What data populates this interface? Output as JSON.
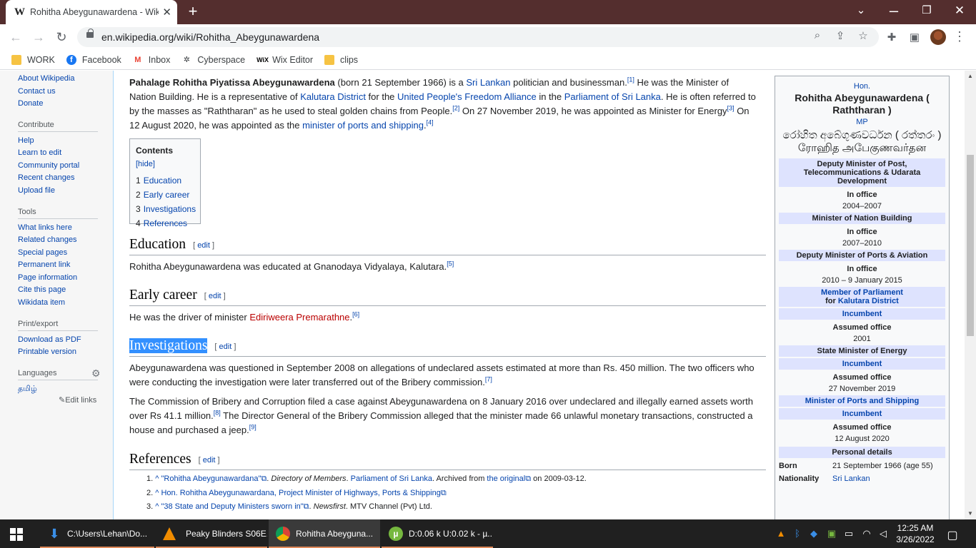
{
  "browser": {
    "tab_title": "Rohitha Abeygunawardena - Wik",
    "url": "en.wikipedia.org/wiki/Rohitha_Abeygunawardena",
    "bookmarks": [
      "WORK",
      "Facebook",
      "Inbox",
      "Cyberspace",
      "Wix Editor",
      "clips"
    ]
  },
  "sidebar": {
    "top_links": [
      "About Wikipedia",
      "Contact us",
      "Donate"
    ],
    "contribute_heading": "Contribute",
    "contribute_links": [
      "Help",
      "Learn to edit",
      "Community portal",
      "Recent changes",
      "Upload file"
    ],
    "tools_heading": "Tools",
    "tools_links": [
      "What links here",
      "Related changes",
      "Special pages",
      "Permanent link",
      "Page information",
      "Cite this page",
      "Wikidata item"
    ],
    "print_heading": "Print/export",
    "print_links": [
      "Download as PDF",
      "Printable version"
    ],
    "languages_heading": "Languages",
    "language_links": [
      "தமிழ்"
    ],
    "edit_links": "Edit links"
  },
  "article": {
    "intro": {
      "name": "Pahalage Rohitha Piyatissa Abeygunawardena",
      "born": " (born 21 September 1966) is a ",
      "sri_lankan": "Sri Lankan",
      "t1": " politician and businessman.",
      "r1": "[1]",
      "t2": " He was the Minister of Nation Building. He is a representative of ",
      "kalutara": "Kalutara District",
      "t3": " for the ",
      "upfa": "United People's Freedom Alliance",
      "t4": " in the ",
      "parliament": "Parliament of Sri Lanka",
      "t5": ". He is often referred to by the masses as \"Raththaran\" as he used to steal golden chains from People.",
      "r2": "[2]",
      "t6": " On 27 November 2019, he was appointed as Minister for Energy",
      "r3": "[3]",
      "t7": " On 12 August 2020, he was appointed as the ",
      "ports": "minister of ports and shipping",
      "t8": ".",
      "r4": "[4]"
    },
    "toc": {
      "title": "Contents",
      "hide": "[hide]",
      "items": [
        {
          "num": "1",
          "label": "Education"
        },
        {
          "num": "2",
          "label": "Early career"
        },
        {
          "num": "3",
          "label": "Investigations"
        },
        {
          "num": "4",
          "label": "References"
        }
      ]
    },
    "edit_open": "[ ",
    "edit_label": "edit",
    "edit_close": " ]",
    "education": {
      "heading": "Education",
      "text": "Rohitha Abeygunawardena was educated at Gnanodaya Vidyalaya, Kalutara.",
      "ref": "[5]"
    },
    "early_career": {
      "heading": "Early career",
      "text": "He was the driver of minister ",
      "link": "Ediriweera Premarathne",
      "end": ".",
      "ref": "[6]"
    },
    "investigations": {
      "heading": "Investigations",
      "p1": "Abeygunawardena was questioned in September 2008 on allegations of undeclared assets estimated at more than Rs. 450 million. The two officers who were conducting the investigation were later transferred out of the Bribery commission.",
      "p1_ref": "[7]",
      "p2a": "The Commission of Bribery and Corruption filed a case against Abeygunawardena on 8 January 2016 over undeclared and illegally earned assets worth over Rs 41.1 million.",
      "p2_ref1": "[8]",
      "p2b": " The Director General of the Bribery Commission alleged that the minister made 66 unlawful monetary transactions, constructed a house and purchased a jeep.",
      "p2_ref2": "[9]"
    },
    "references": {
      "heading": "References",
      "r1": {
        "num": "1.",
        "caret": "^",
        "title": "\"Rohitha Abeygunawardana\"",
        "ext": "⧉",
        "t1": ". ",
        "italic": "Directory of Members",
        "t2": ". ",
        "pub": "Parliament of Sri Lanka",
        "t3": ". Archived from ",
        "orig": "the original",
        "t4": " on 2009-03-12."
      },
      "r2": {
        "num": "2.",
        "caret": "^",
        "title": "Hon. Rohitha Abeygunawardana, Project Minister of Highways, Ports & Shipping",
        "ext": "⧉"
      },
      "r3": {
        "num": "3.",
        "caret": "^",
        "title": "\"38 State and Deputy Ministers sworn in\"",
        "ext": "⧉",
        "t1": ". ",
        "italic": "Newsfirst",
        "t2": ". MTV Channel (Pvt) Ltd."
      }
    }
  },
  "infobox": {
    "honorific": "Hon.",
    "name": "Rohitha Abeygunawardena ( Raththaran )",
    "post_nominal": "MP",
    "sinhala": "රෝහිත අබේගුණවර්ධන ( රත්තරං )",
    "tamil": "ரோஹித அபேகுணவர்தன",
    "offices": [
      {
        "title": "Deputy Minister of Post, Telecommunications & Udarata Development",
        "status": "In office",
        "dates": "2004–2007"
      },
      {
        "title": "Minister of Nation Building",
        "status": "In office",
        "dates": "2007–2010"
      },
      {
        "title": "Deputy Minister of Ports & Aviation",
        "status": "In office",
        "dates": "2010 – 9 January 2015"
      }
    ],
    "mp_title": "Member of Parliament",
    "mp_for": "for ",
    "mp_district": "Kalutara District",
    "incumbent": "Incumbent",
    "assumed": "Assumed office",
    "mp_date": "2001",
    "energy_title": "State Minister of Energy",
    "energy_date": "27 November 2019",
    "ports_title": "Minister of Ports and Shipping",
    "ports_date": "12 August 2020",
    "personal": "Personal details",
    "born_label": "Born",
    "born_value": "21 September 1966 (age 55)",
    "nationality_label": "Nationality",
    "nationality_value": "Sri Lankan"
  },
  "taskbar": {
    "items": [
      "C:\\Users\\Lehan\\Do...",
      "Peaky Blinders S06E...",
      "Rohitha Abeyguna...",
      "D:0.06 k U:0.02 k - µ..."
    ],
    "time": "12:25 AM",
    "date": "3/26/2022"
  }
}
